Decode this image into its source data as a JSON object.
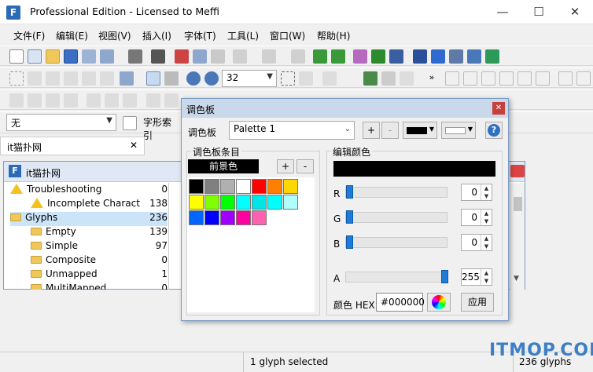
{
  "window": {
    "title": "Professional Edition - Licensed to Meffi"
  },
  "menu": [
    "文件(F)",
    "编辑(E)",
    "视图(V)",
    "插入(I)",
    "字体(T)",
    "工具(L)",
    "窗口(W)",
    "帮助(H)"
  ],
  "toolbar": {
    "zoom_value": "32",
    "style_value": "无",
    "glyph_index_label": "字形索引"
  },
  "tab": {
    "label": "it猫扑网"
  },
  "docwin": {
    "title": "it猫扑网",
    "tree": [
      {
        "label": "Troubleshooting",
        "count": "0",
        "indent": 0,
        "icon": "warning"
      },
      {
        "label": "Incomplete Charact",
        "count": "138",
        "indent": 1,
        "icon": "warning"
      },
      {
        "label": "Glyphs",
        "count": "236",
        "indent": 0,
        "icon": "folder"
      },
      {
        "label": "Empty",
        "count": "139",
        "indent": 1,
        "icon": "folder"
      },
      {
        "label": "Simple",
        "count": "97",
        "indent": 1,
        "icon": "folder"
      },
      {
        "label": "Composite",
        "count": "0",
        "indent": 1,
        "icon": "folder"
      },
      {
        "label": "Unmapped",
        "count": "1",
        "indent": 1,
        "icon": "folder"
      },
      {
        "label": "MultiMapped",
        "count": "0",
        "indent": 1,
        "icon": "folder"
      }
    ]
  },
  "palette": {
    "title": "调色板",
    "palette_label": "调色板",
    "palette_value": "Palette 1",
    "add": "+",
    "remove": "-",
    "entries_title": "调色板条目",
    "foreground": "前景色",
    "edit_title": "编辑颜色",
    "r_label": "R",
    "r_value": "0",
    "g_label": "G",
    "g_value": "0",
    "b_label": "B",
    "b_value": "0",
    "a_label": "A",
    "a_value": "255",
    "alpha_level": 1.0,
    "hex_label": "颜色 HEX",
    "hex_value": "#000000",
    "apply": "应用",
    "colors": [
      "#000000",
      "#808080",
      "#b0b0b0",
      "#ffffff",
      "#ff0000",
      "#ff7f00",
      "#ffd700",
      "#ffff00",
      "#7fff00",
      "#00ff00",
      "#00ffff",
      "#00e5e5",
      "#00ffff",
      "#b0ffff",
      "#0066ff",
      "#0000ff",
      "#a000ff",
      "#ff00a0",
      "#ff60b0"
    ]
  },
  "status": {
    "selection": "1 glyph selected",
    "total": "236 glyphs"
  },
  "watermark": "ITMOP.COM"
}
